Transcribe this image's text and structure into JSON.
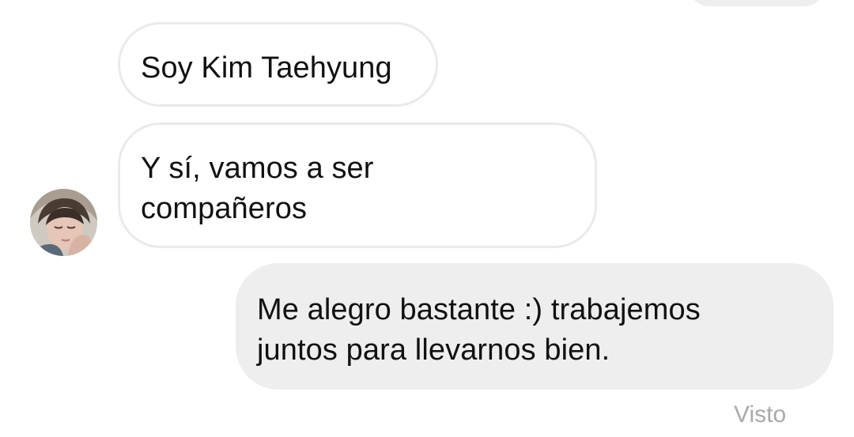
{
  "conversation": {
    "messages": [
      {
        "direction": "incoming",
        "text": "Soy Kim Taehyung"
      },
      {
        "direction": "incoming",
        "text": "Y sí, vamos a ser compañeros"
      },
      {
        "direction": "outgoing",
        "text": "Me alegro bastante :) trabajemos juntos para llevarnos bien."
      }
    ],
    "status": "Visto"
  },
  "icons": {
    "avatar": "user-avatar-photo"
  },
  "colors": {
    "incoming_bubble_bg": "#ffffff",
    "incoming_bubble_border": "#eaeaea",
    "outgoing_bubble_bg": "#eeeeee",
    "text": "#111111",
    "status_text": "#a9a9a9"
  }
}
